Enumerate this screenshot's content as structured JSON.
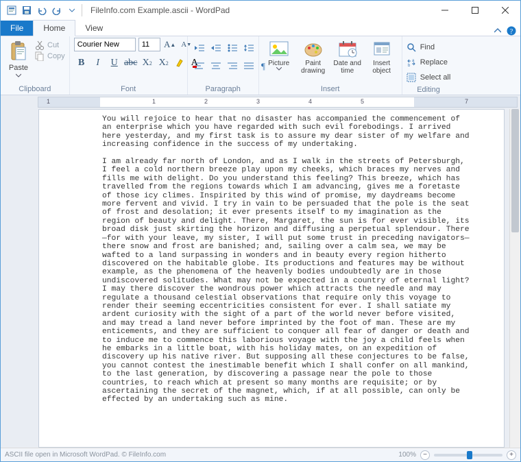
{
  "title": "FileInfo.com Example.ascii - WordPad",
  "tabs": {
    "file": "File",
    "home": "Home",
    "view": "View"
  },
  "clipboard": {
    "paste": "Paste",
    "cut": "Cut",
    "copy": "Copy",
    "group": "Clipboard"
  },
  "font": {
    "name": "Courier New",
    "size": "11",
    "group": "Font"
  },
  "paragraph": {
    "group": "Paragraph"
  },
  "insert": {
    "picture": "Picture",
    "paint": "Paint\ndrawing",
    "datetime": "Date and\ntime",
    "object": "Insert\nobject",
    "group": "Insert"
  },
  "editing": {
    "find": "Find",
    "replace": "Replace",
    "selectall": "Select all",
    "group": "Editing"
  },
  "ruler_numbers": [
    "1",
    "1",
    "2",
    "3",
    "4",
    "5",
    "7"
  ],
  "document_text": "You will rejoice to hear that no disaster has accompanied the commencement of an enterprise which you have regarded with such evil forebodings. I arrived here yesterday, and my first task is to assure my dear sister of my welfare and increasing confidence in the success of my undertaking.\n\nI am already far north of London, and as I walk in the streets of Petersburgh, I feel a cold northern breeze play upon my cheeks, which braces my nerves and fills me with delight. Do you understand this feeling? This breeze, which has travelled from the regions towards which I am advancing, gives me a foretaste of those icy climes. Inspirited by this wind of promise, my daydreams become more fervent and vivid. I try in vain to be persuaded that the pole is the seat of frost and desolation; it ever presents itself to my imagination as the region of beauty and delight. There, Margaret, the sun is for ever visible, its broad disk just skirting the horizon and diffusing a perpetual splendour. There—for with your leave, my sister, I will put some trust in preceding navigators—there snow and frost are banished; and, sailing over a calm sea, we may be wafted to a land surpassing in wonders and in beauty every region hitherto discovered on the habitable globe. Its productions and features may be without example, as the phenomena of the heavenly bodies undoubtedly are in those undiscovered solitudes. What may not be expected in a country of eternal light? I may there discover the wondrous power which attracts the needle and may regulate a thousand celestial observations that require only this voyage to render their seeming eccentricities consistent for ever. I shall satiate my ardent curiosity with the sight of a part of the world never before visited, and may tread a land never before imprinted by the foot of man. These are my enticements, and they are sufficient to conquer all fear of danger or death and to induce me to commence this laborious voyage with the joy a child feels when he embarks in a little boat, with his holiday mates, on an expedition of discovery up his native river. But supposing all these conjectures to be false, you cannot contest the inestimable benefit which I shall confer on all mankind, to the last generation, by discovering a passage near the pole to those countries, to reach which at present so many months are requisite; or by ascertaining the secret of the magnet, which, if at all possible, can only be effected by an undertaking such as mine.",
  "status": {
    "caption": "ASCII file open in Microsoft WordPad. © FileInfo.com",
    "zoom": "100%"
  }
}
